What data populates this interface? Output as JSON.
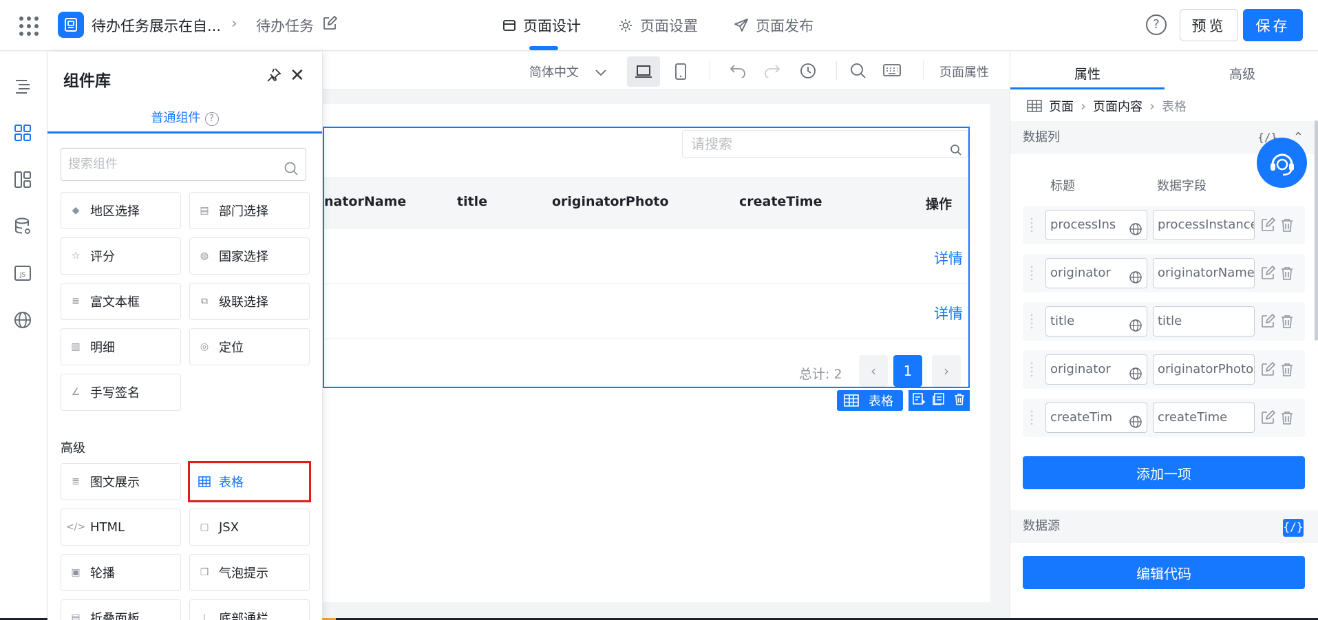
{
  "header": {
    "app_title": "待办任务展示在自...",
    "page_name": "待办任务",
    "tabs": [
      {
        "label": "页面设计"
      },
      {
        "label": "页面设置"
      },
      {
        "label": "页面发布"
      }
    ],
    "help": "?",
    "preview_label": "预览",
    "save_label": "保存"
  },
  "library": {
    "title": "组件库",
    "tab_label": "普通组件",
    "search_placeholder": "搜索组件",
    "components": [
      {
        "label": "地区选择",
        "icon": "map-icon"
      },
      {
        "label": "部门选择",
        "icon": "org-icon"
      },
      {
        "label": "评分",
        "icon": "star-icon"
      },
      {
        "label": "国家选择",
        "icon": "globe-icon"
      },
      {
        "label": "富文本框",
        "icon": "richtext-icon"
      },
      {
        "label": "级联选择",
        "icon": "cascade-icon"
      },
      {
        "label": "明细",
        "icon": "detail-icon"
      },
      {
        "label": "定位",
        "icon": "location-icon"
      },
      {
        "label": "手写签名",
        "icon": "pen-icon"
      }
    ],
    "advanced_title": "高级",
    "advanced": [
      {
        "label": "图文展示",
        "icon": "image-text-icon"
      },
      {
        "label": "表格",
        "icon": "table-icon"
      },
      {
        "label": "HTML",
        "icon": "code-icon"
      },
      {
        "label": "JSX",
        "icon": "jsx-icon"
      },
      {
        "label": "轮播",
        "icon": "carousel-icon"
      },
      {
        "label": "气泡提示",
        "icon": "tooltip-icon"
      },
      {
        "label": "折叠面板",
        "icon": "collapse-icon"
      },
      {
        "label": "底部通栏",
        "icon": "footer-icon"
      }
    ]
  },
  "toolbar": {
    "language": "简体中文",
    "page_props": "页面属性"
  },
  "table": {
    "search_placeholder": "请搜索",
    "columns": [
      "natorName",
      "title",
      "originatorPhoto",
      "createTime",
      "操作"
    ],
    "rows": [
      {
        "action": "详情"
      },
      {
        "action": "详情"
      }
    ],
    "total": "总计: 2",
    "current_page": "1",
    "tag_label": "表格"
  },
  "props_panel": {
    "tabs": [
      "属性",
      "高级"
    ],
    "breadcrumb": [
      "页面",
      "页面内容",
      "表格"
    ],
    "data_cols_title": "数据列",
    "code_symbol": "{/}",
    "col_title_header": "标题",
    "col_field_header": "数据字段",
    "data_rows": [
      {
        "title": "processIns",
        "field": "processInstance"
      },
      {
        "title": "originator",
        "field": "originatorName"
      },
      {
        "title": "title",
        "field": "title"
      },
      {
        "title": "originator",
        "field": "originatorPhoto"
      },
      {
        "title": "createTim",
        "field": "createTime"
      }
    ],
    "add_label": "添加一项",
    "datasource_title": "数据源",
    "edit_code_label": "编辑代码"
  },
  "colors": {
    "primary": "#1677ff",
    "highlight": "#e41b1b"
  }
}
